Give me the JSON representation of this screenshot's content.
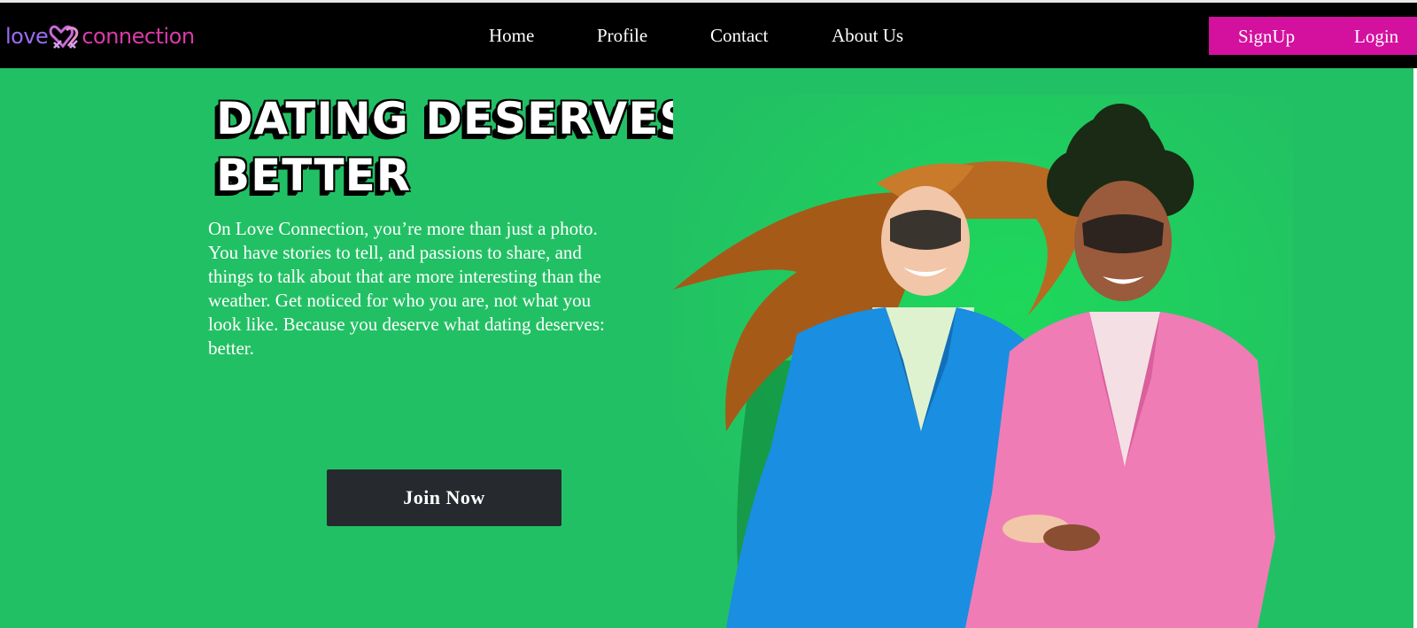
{
  "brand": {
    "logo_left": "love",
    "logo_right": "connection",
    "colors": {
      "love": "#9b6cf0",
      "connection": "#d93aa8",
      "heart": "#c86ad8"
    }
  },
  "nav": {
    "items": [
      {
        "label": "Home"
      },
      {
        "label": "Profile"
      },
      {
        "label": "Contact"
      },
      {
        "label": "About Us"
      }
    ],
    "auth": {
      "signup": "SignUp",
      "login": "Login",
      "accent": "#d4109f"
    }
  },
  "hero": {
    "headline_line1": "DATING DESERVES",
    "headline_line2": "BETTER",
    "description": "On Love Connection, you’re more than just a photo. You have stories to tell, and passions to share, and things to talk about that are more interesting than the weather. Get noticed for who you are, not what you look like. Because you deserve what dating deserves: better.",
    "cta": "Join Now",
    "background": "#22c064",
    "image": "couple-photo"
  }
}
